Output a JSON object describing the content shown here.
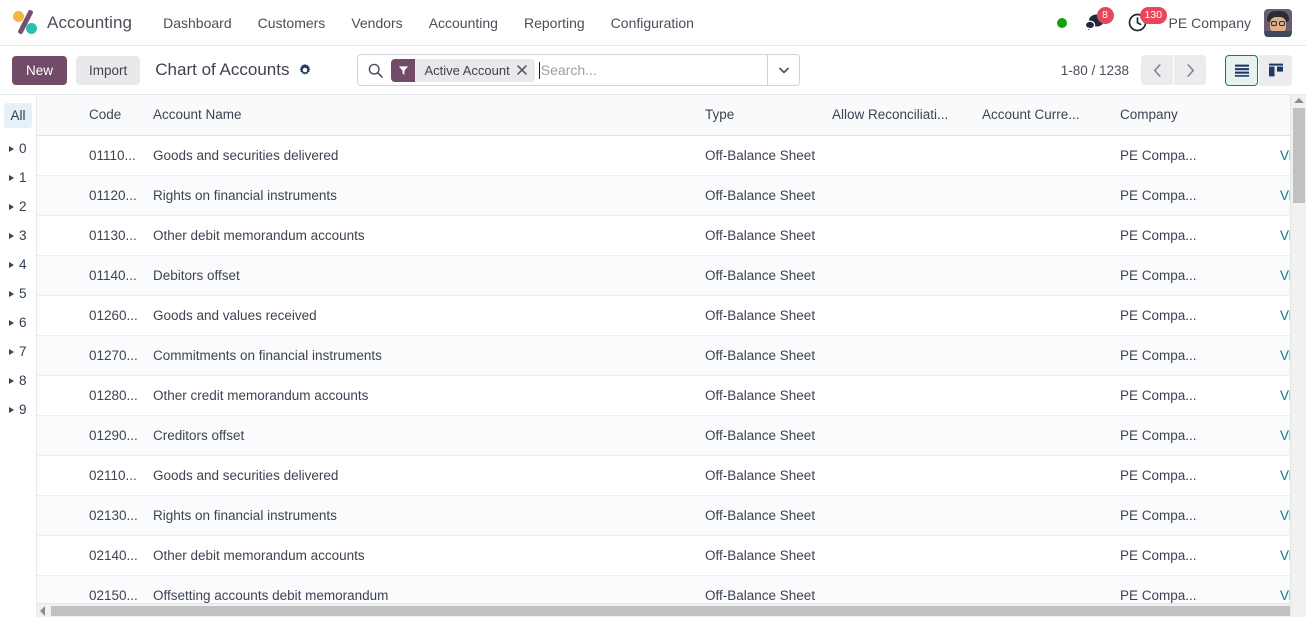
{
  "navbar": {
    "brand": "Accounting",
    "logo_icon": "odoo-logo",
    "menu": [
      {
        "label": "Dashboard"
      },
      {
        "label": "Customers"
      },
      {
        "label": "Vendors"
      },
      {
        "label": "Accounting"
      },
      {
        "label": "Reporting"
      },
      {
        "label": "Configuration"
      }
    ],
    "status_dot_color": "#15a10b",
    "messages_icon": "chat-bubble-icon",
    "messages_count": "8",
    "activities_icon": "clock-icon",
    "activities_count": "130",
    "company": "PE Company",
    "avatar_icon": "user-avatar"
  },
  "control_panel": {
    "new_label": "New",
    "import_label": "Import",
    "breadcrumb": "Chart of Accounts",
    "settings_icon": "gear-icon",
    "search": {
      "search_icon": "search-icon",
      "facet_icon": "filter-funnel-icon",
      "facet_label": "Active Account",
      "facet_remove_icon": "close-x-icon",
      "placeholder": "Search...",
      "value": "",
      "dropdown_icon": "chevron-down-icon"
    },
    "pager": {
      "range": "1-80 / 1238",
      "prev_icon": "chevron-left-icon",
      "next_icon": "chevron-right-icon"
    },
    "view_switcher": [
      {
        "name": "list-view",
        "icon": "list-icon",
        "active": true
      },
      {
        "name": "kanban-view",
        "icon": "kanban-icon",
        "active": false
      }
    ]
  },
  "sidebar": {
    "all_label": "All",
    "items": [
      {
        "label": "0"
      },
      {
        "label": "1"
      },
      {
        "label": "2"
      },
      {
        "label": "3"
      },
      {
        "label": "4"
      },
      {
        "label": "5"
      },
      {
        "label": "6"
      },
      {
        "label": "7"
      },
      {
        "label": "8"
      },
      {
        "label": "9"
      }
    ]
  },
  "table": {
    "columns": {
      "code": "Code",
      "name": "Account Name",
      "type": "Type",
      "reconciliation": "Allow Reconciliati...",
      "currency": "Account Curre...",
      "company": "Company",
      "options_icon": "column-options-icon"
    },
    "view_link_label": "View",
    "rows": [
      {
        "code": "01110...",
        "name": "Goods and securities delivered",
        "type": "Off-Balance Sheet",
        "reconciliation": "",
        "currency": "",
        "company": "PE Compa...",
        "view": "View"
      },
      {
        "code": "01120...",
        "name": "Rights on financial instruments",
        "type": "Off-Balance Sheet",
        "reconciliation": "",
        "currency": "",
        "company": "PE Compa...",
        "view": "View"
      },
      {
        "code": "01130...",
        "name": "Other debit memorandum accounts",
        "type": "Off-Balance Sheet",
        "reconciliation": "",
        "currency": "",
        "company": "PE Compa...",
        "view": "View"
      },
      {
        "code": "01140...",
        "name": "Debitors offset",
        "type": "Off-Balance Sheet",
        "reconciliation": "",
        "currency": "",
        "company": "PE Compa...",
        "view": "View"
      },
      {
        "code": "01260...",
        "name": "Goods and values received",
        "type": "Off-Balance Sheet",
        "reconciliation": "",
        "currency": "",
        "company": "PE Compa...",
        "view": "View"
      },
      {
        "code": "01270...",
        "name": "Commitments on financial instruments",
        "type": "Off-Balance Sheet",
        "reconciliation": "",
        "currency": "",
        "company": "PE Compa...",
        "view": "View"
      },
      {
        "code": "01280...",
        "name": "Other credit memorandum accounts",
        "type": "Off-Balance Sheet",
        "reconciliation": "",
        "currency": "",
        "company": "PE Compa...",
        "view": "View"
      },
      {
        "code": "01290...",
        "name": "Creditors offset",
        "type": "Off-Balance Sheet",
        "reconciliation": "",
        "currency": "",
        "company": "PE Compa...",
        "view": "View"
      },
      {
        "code": "02110...",
        "name": "Goods and securities delivered",
        "type": "Off-Balance Sheet",
        "reconciliation": "",
        "currency": "",
        "company": "PE Compa...",
        "view": "View"
      },
      {
        "code": "02130...",
        "name": "Rights on financial instruments",
        "type": "Off-Balance Sheet",
        "reconciliation": "",
        "currency": "",
        "company": "PE Compa...",
        "view": "View"
      },
      {
        "code": "02140...",
        "name": "Other debit memorandum accounts",
        "type": "Off-Balance Sheet",
        "reconciliation": "",
        "currency": "",
        "company": "PE Compa...",
        "view": "View"
      },
      {
        "code": "02150...",
        "name": "Offsetting accounts debit memorandum",
        "type": "Off-Balance Sheet",
        "reconciliation": "",
        "currency": "",
        "company": "PE Compa...",
        "view": "View"
      }
    ]
  },
  "colors": {
    "brand_purple": "#714b67",
    "accent_teal": "#017e84",
    "badge_red": "#e6475b",
    "status_green": "#15a10b"
  }
}
